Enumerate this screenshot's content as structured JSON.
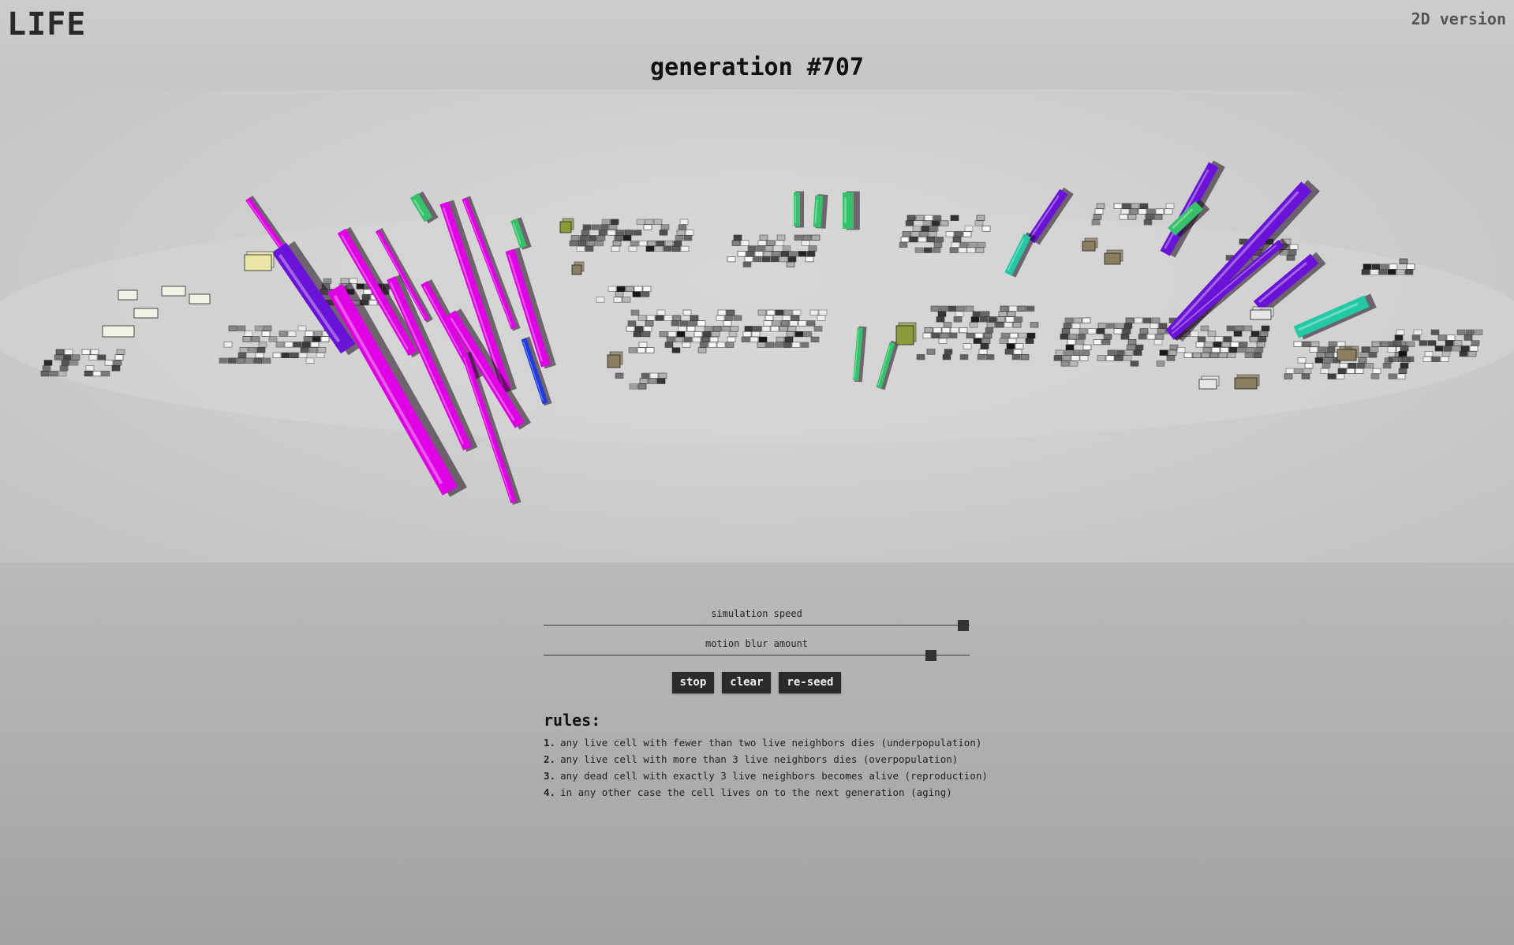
{
  "header": {
    "logo": "LIFE",
    "alt_version_link": "2D version",
    "generation_label": "generation #",
    "generation_number": "707"
  },
  "controls": {
    "sliders": [
      {
        "label": "simulation speed",
        "value_fraction": 0.985
      },
      {
        "label": "motion blur amount",
        "value_fraction": 0.91
      }
    ],
    "buttons": {
      "stop": "stop",
      "clear": "clear",
      "reseed": "re-seed"
    }
  },
  "rules": {
    "title": "rules:",
    "items": [
      {
        "num": "1.",
        "text": "any live cell with fewer than two live neighbors dies (underpopulation)"
      },
      {
        "num": "2.",
        "text": "any live cell with more than 3 live neighbors dies (overpopulation)"
      },
      {
        "num": "3.",
        "text": "any dead cell with exactly 3 live neighbors becomes alive (reproduction)"
      },
      {
        "num": "4.",
        "text": "in any other case the cell lives on to the next generation (aging)"
      }
    ]
  },
  "palette": {
    "magenta": "#e000e6",
    "violet": "#6a12d8",
    "green": "#35c26a",
    "teal": "#22c9a4",
    "olive": "#8c9a3c",
    "cream": "#e9e6a8",
    "khaki": "#8a7d60",
    "blue": "#1f3be0"
  }
}
